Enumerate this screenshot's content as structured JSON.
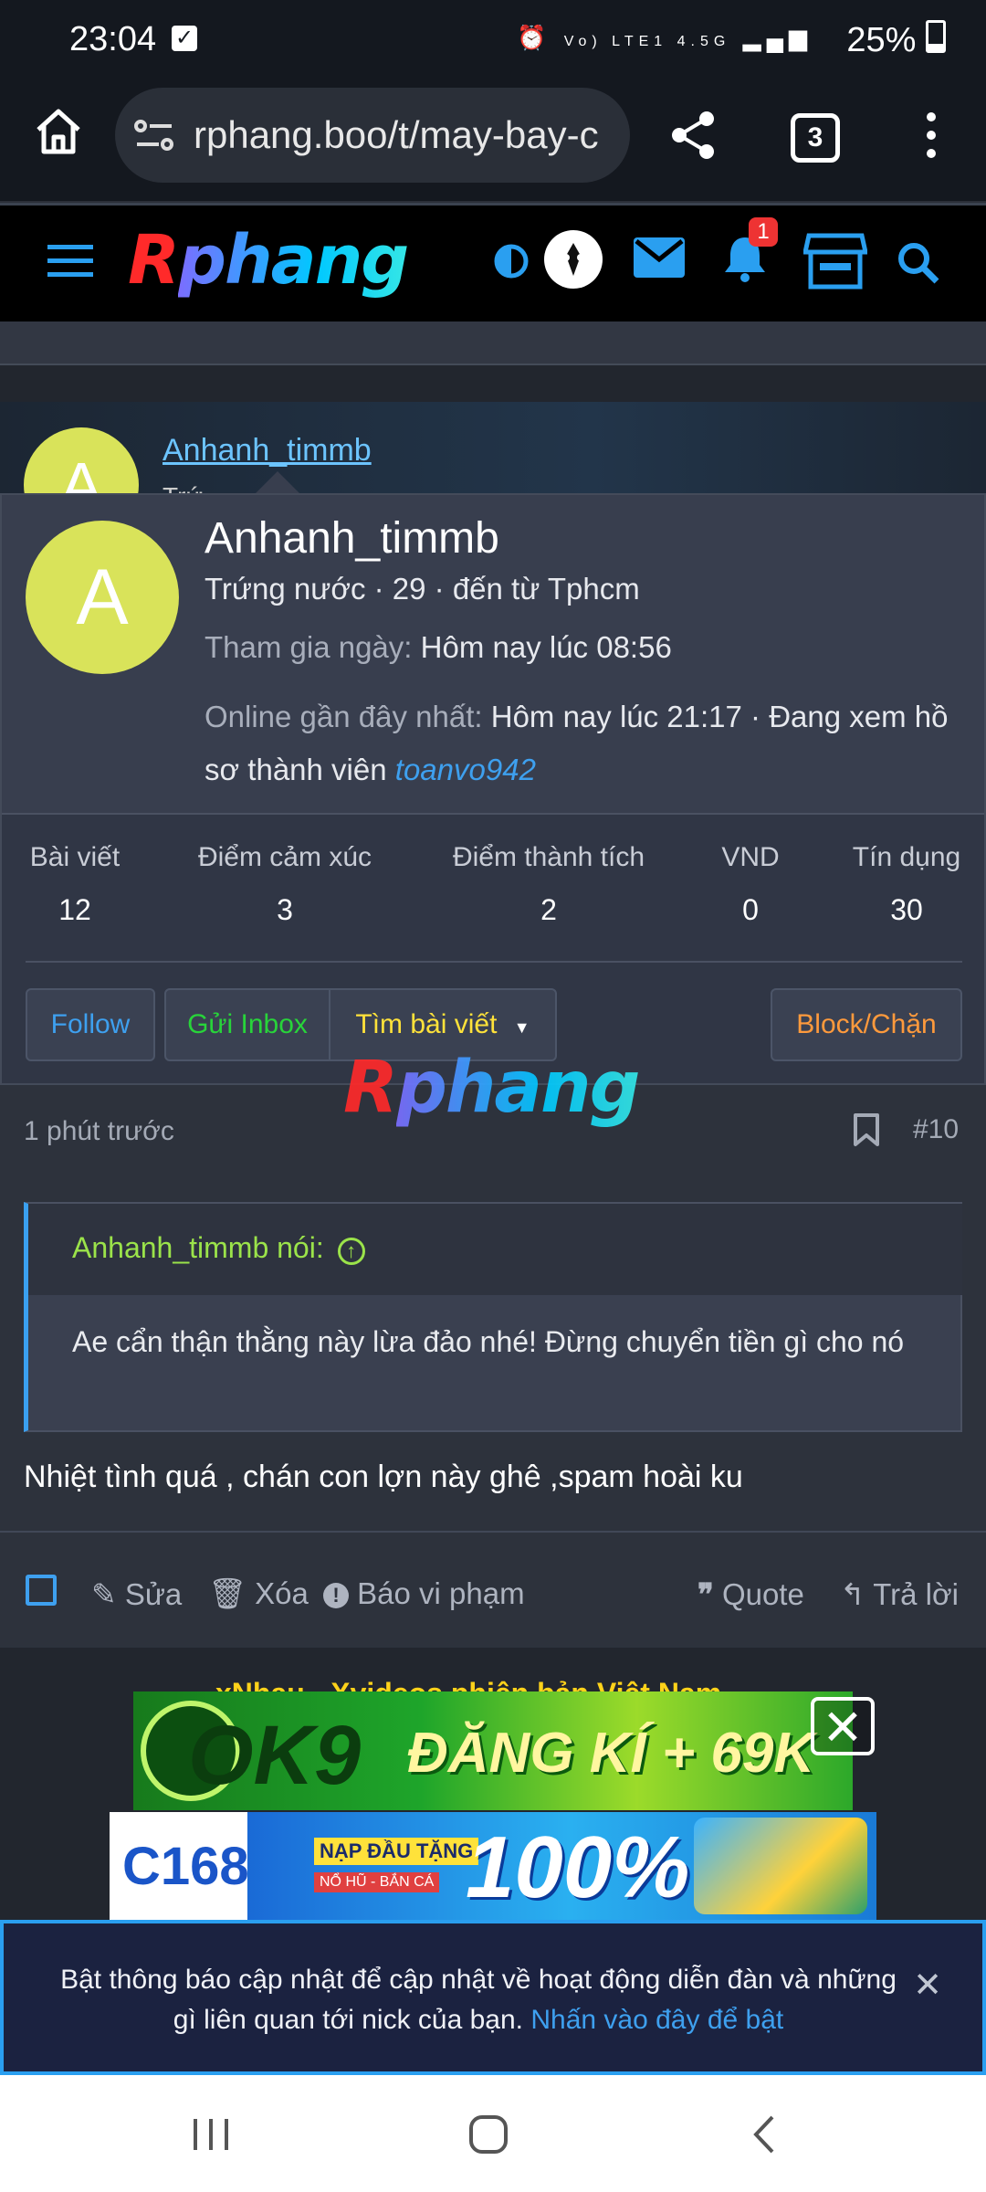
{
  "status_bar": {
    "time": "23:04",
    "network": "Vo) LTE1 4.5G",
    "battery": "25%",
    "icons": [
      "check-notification-icon",
      "alarm-icon",
      "signal-icon",
      "battery-icon"
    ]
  },
  "browser": {
    "url": "rphang.boo/t/may-bay-c",
    "tab_count": "3"
  },
  "site": {
    "logo_r": "R",
    "logo_rest": "phang",
    "notification_count": "1"
  },
  "post_author_behind": {
    "name": "Anhanh_timmb",
    "sub": "Trứ"
  },
  "profile_popup": {
    "avatar_letter": "A",
    "name": "Anhanh_timmb",
    "subtitle": "Trứng nước · 29 · đến từ Tphcm",
    "joined_label": "Tham gia ngày:",
    "joined_value": "Hôm nay lúc 08:56",
    "last_seen_label": "Online gần đây nhất:",
    "last_seen_value": "Hôm nay lúc 21:17 · Đang xem hồ",
    "last_seen_line2": "sơ thành viên",
    "viewing_user": "toanvo942",
    "stats": [
      {
        "label": "Bài viết",
        "value": "12"
      },
      {
        "label": "Điểm cảm xúc",
        "value": "3"
      },
      {
        "label": "Điểm thành tích",
        "value": "2"
      },
      {
        "label": "VND",
        "value": "0"
      },
      {
        "label": "Tín dụng",
        "value": "30"
      }
    ],
    "follow_label": "Follow",
    "inbox_label": "Gửi Inbox",
    "find_posts_label": "Tìm bài viết",
    "block_label": "Block/Chặn"
  },
  "watermark": {
    "r": "R",
    "rest": "phang"
  },
  "post": {
    "time": "1 phút trước",
    "number": "#10",
    "quote_author": "Anhanh_timmb nói:",
    "quote_text": "Ae cẩn thận thằng này lừa đảo nhé! Đừng chuyển tiền gì cho nó",
    "message": "Nhiệt tình quá , chán con lợn này ghê ,spam hoài ku",
    "actions": {
      "edit": "Sửa",
      "delete": "Xóa",
      "report": "Báo vi phạm",
      "quote": "Quote",
      "reply": "Trả lời"
    }
  },
  "ads": {
    "banner_text_behind": "xNhau - Xvideos phiên bản Việt Nam",
    "ad1_brand": "OK9",
    "ad1_text": "ĐĂNG KÍ + 69K",
    "ad2_brand": "C168",
    "ad2_small1": "NẠP ĐẦU TẶNG",
    "ad2_small2": "NỔ HŨ - BẮN CÁ",
    "ad2_text": "100%"
  },
  "notice": {
    "text": "Bật thông báo cập nhật để cập nhật về hoạt động diễn đàn và những gì liên quan tới nick của bạn.",
    "link": "Nhấn vào đây để bật"
  },
  "colors": {
    "accent_blue": "#2a9ff0",
    "avatar_yellow": "#d9e35a",
    "green": "#28d43a",
    "yellow": "#ffe23a",
    "orange": "#ff9a3c"
  }
}
